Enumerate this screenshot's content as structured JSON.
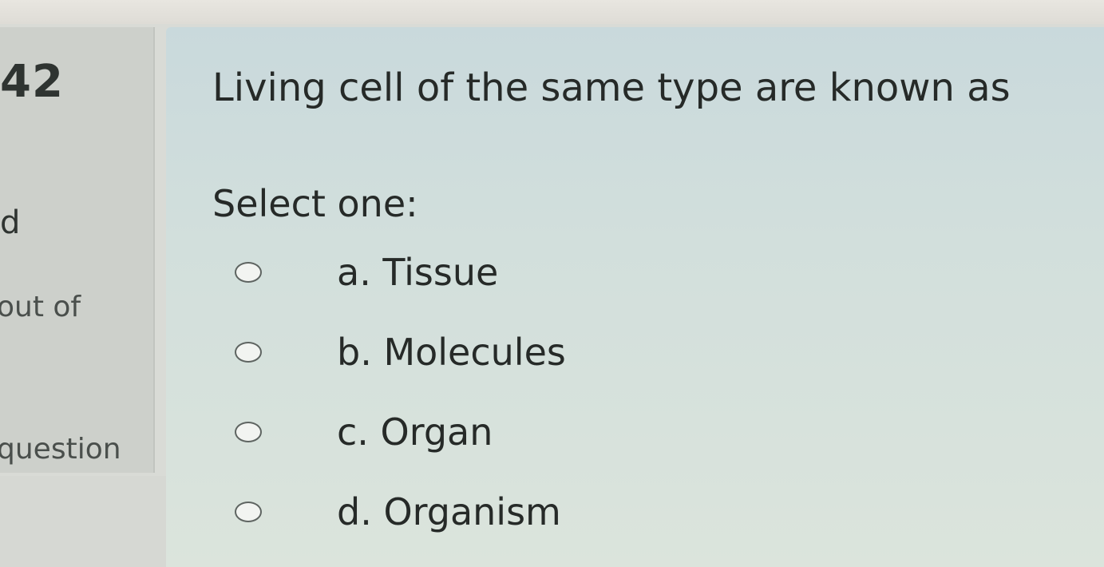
{
  "info": {
    "question_number": "42",
    "status_mark": "d",
    "marks_text": "out of",
    "flag_text": "question"
  },
  "question": {
    "text": "Living cell of the same type are known as",
    "prompt": "Select one:",
    "answers": [
      {
        "label": "a. Tissue"
      },
      {
        "label": "b. Molecules"
      },
      {
        "label": "c. Organ"
      },
      {
        "label": "d. Organism"
      }
    ]
  }
}
